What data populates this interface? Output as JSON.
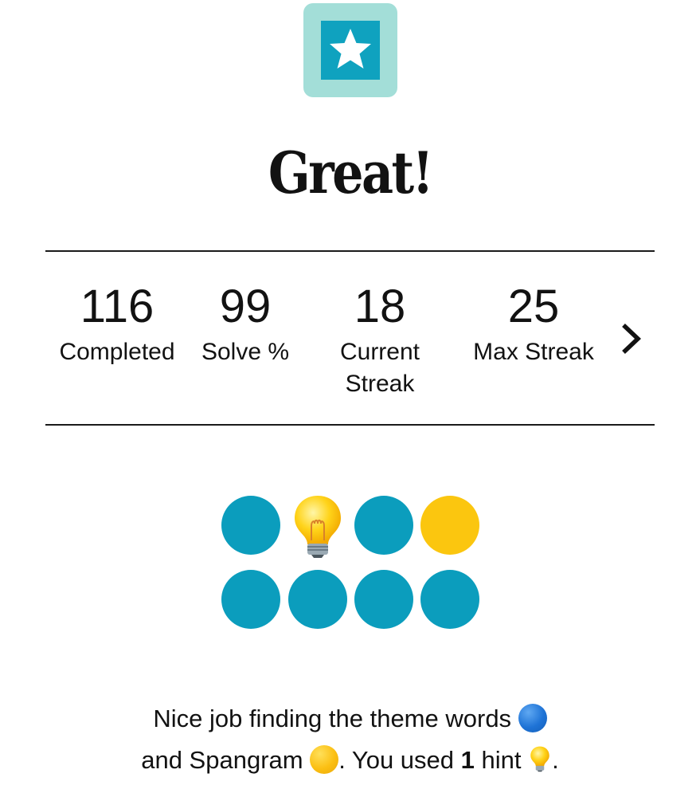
{
  "badge": {
    "icon": "star-icon",
    "bg_color": "#a3ded8",
    "inner_color": "#0fa2bf"
  },
  "title": "Great!",
  "stats": [
    {
      "value": "116",
      "label": "Completed"
    },
    {
      "value": "99",
      "label": "Solve %"
    },
    {
      "value": "18",
      "label": "Current Streak"
    },
    {
      "value": "25",
      "label": "Max Streak"
    }
  ],
  "stats_next_icon": "chevron-right-icon",
  "results": {
    "row1": [
      "theme",
      "hint",
      "theme",
      "spangram"
    ],
    "row2": [
      "theme",
      "theme",
      "theme",
      "theme"
    ],
    "colors": {
      "theme": "#0b9dbd",
      "spangram": "#fbc60f"
    }
  },
  "message": {
    "part1": "Nice job finding the theme words",
    "part2": "and Spangram",
    "part3": ". You used",
    "hint_count": "1",
    "part4": "hint",
    "part5": "."
  }
}
